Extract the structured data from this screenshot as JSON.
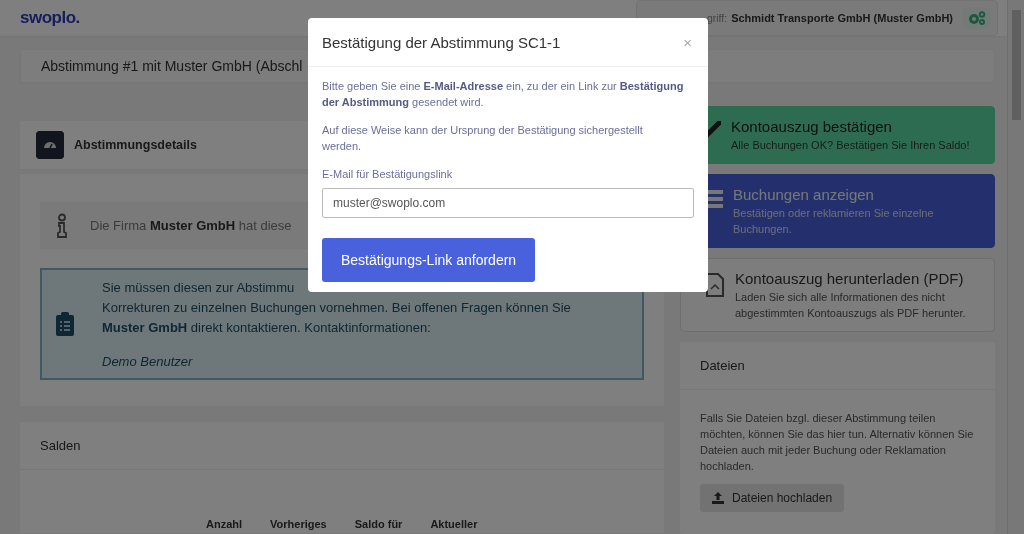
{
  "header": {
    "logo": "swoplo.",
    "access_label": "griff:",
    "access_value": "Schmidt Transporte GmbH (Muster GmbH)"
  },
  "title": "Abstimmung #1 mit Muster GmbH (Abschl",
  "details": {
    "heading": "Abstimmungsdetails",
    "info": "Die Firma **Muster GmbH** hat diese",
    "notice_lines": [
      "Sie müssen diesen zur Abstimmu",
      "Korrekturen zu einzelnen Buchungen vornehmen. Bei offenen Fragen können Sie",
      "**Muster GmbH** direkt kontaktieren. Kontaktinformationen:"
    ],
    "contact": "Demo Benutzer"
  },
  "balances": {
    "heading": "Salden",
    "columns": [
      "Anzahl",
      "Vorheriges",
      "Saldo für",
      "Aktueller"
    ]
  },
  "actions": [
    {
      "kind": "confirm",
      "title": "Kontoauszug bestätigen",
      "description": "Alle Buchungen OK? Bestätigen Sie Ihren Saldo!"
    },
    {
      "kind": "list",
      "title": "Buchungen anzeigen",
      "description": "Bestätigen oder reklamieren Sie einzelne Buchungen."
    },
    {
      "kind": "download",
      "title": "Kontoauszug herunterladen (PDF)",
      "description": "Laden Sie sich alle Informationen des nicht abgestimmten Kontoauszugs als PDF herunter."
    }
  ],
  "files": {
    "heading": "Dateien",
    "text": "Falls Sie Dateien bzgl. dieser Abstimmung teilen möchten, können Sie das hier tun. Alternativ können Sie Dateien auch mit jeder Buchung oder Reklamation hochladen.",
    "button": "Dateien hochladen"
  },
  "modal": {
    "title": "Bestätigung der Abstimmung SC1-1",
    "close": "×",
    "intro": "Bitte geben Sie eine **E-Mail-Adresse** ein, zu der ein Link zur **Bestätigung der Abstimmung** gesendet wird.",
    "note": "Auf diese Weise kann der Ursprung der Bestätigung sichergestellt werden.",
    "field_label": "E-Mail für Bestätigungslink",
    "field_value": "muster@swoplo.com",
    "submit": "Bestätigungs-Link anfordern"
  }
}
